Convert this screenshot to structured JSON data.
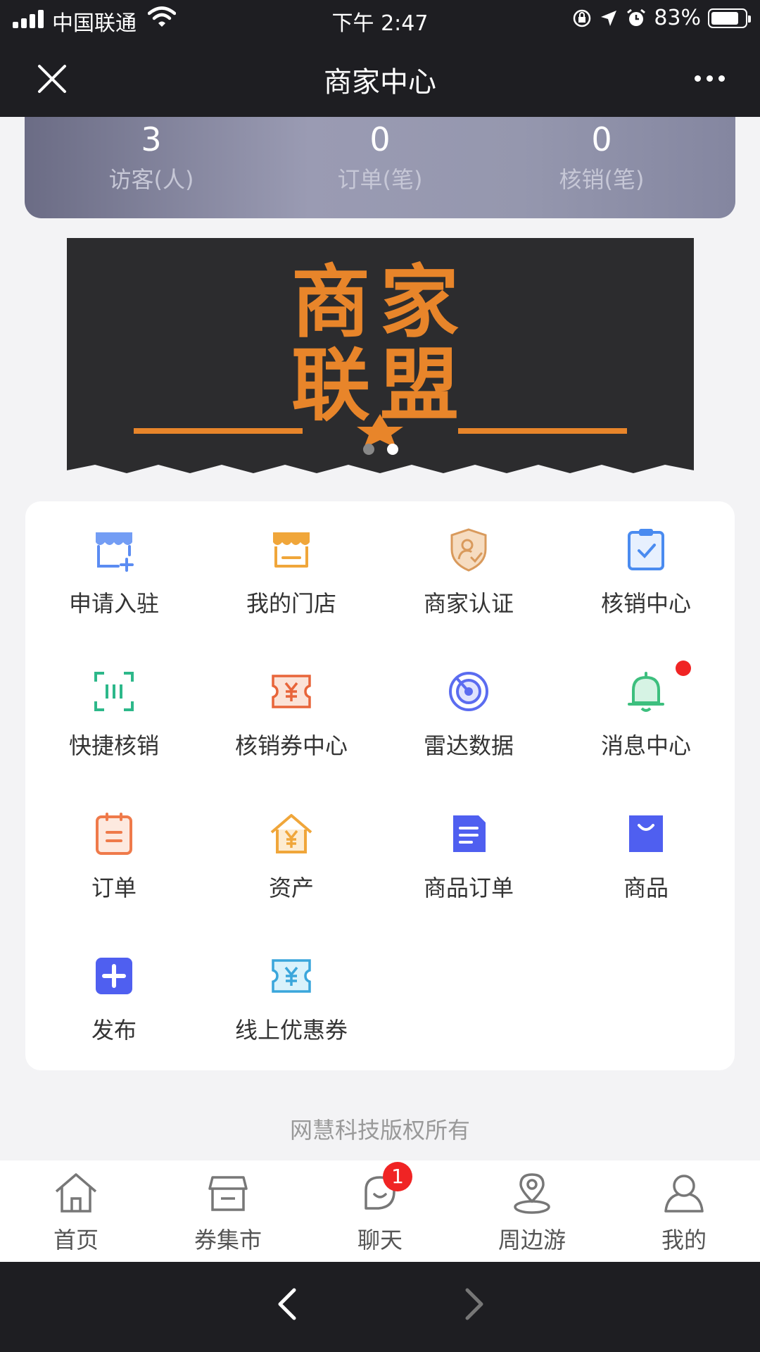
{
  "status_bar": {
    "carrier": "中国联通",
    "time": "下午 2:47",
    "battery": "83%",
    "battery_level": 0.83
  },
  "header": {
    "title": "商家中心",
    "close_icon": "close-icon",
    "more_icon": "more-icon"
  },
  "stats": [
    {
      "value": "3",
      "label": "访客(人)"
    },
    {
      "value": "0",
      "label": "订单(笔)"
    },
    {
      "value": "0",
      "label": "核销(笔)"
    }
  ],
  "banner": {
    "logo_text": "商家联盟",
    "slide_count": 2,
    "active_slide": 2
  },
  "grid": [
    {
      "label": "申请入驻",
      "icon": "store-add-icon"
    },
    {
      "label": "我的门店",
      "icon": "store-icon"
    },
    {
      "label": "商家认证",
      "icon": "shield-user-icon"
    },
    {
      "label": "核销中心",
      "icon": "clipboard-check-icon"
    },
    {
      "label": "快捷核销",
      "icon": "scan-icon"
    },
    {
      "label": "核销券中心",
      "icon": "yen-ticket-icon"
    },
    {
      "label": "雷达数据",
      "icon": "radar-icon"
    },
    {
      "label": "消息中心",
      "icon": "bell-icon"
    },
    {
      "label": "订单",
      "icon": "order-icon"
    },
    {
      "label": "资产",
      "icon": "house-yen-icon"
    },
    {
      "label": "商品订单",
      "icon": "document-icon"
    },
    {
      "label": "商品",
      "icon": "bag-icon"
    },
    {
      "label": "发布",
      "icon": "plus-icon"
    },
    {
      "label": "线上优惠券",
      "icon": "coupon-icon"
    }
  ],
  "copyright": "网慧科技版权所有",
  "tabbar": [
    {
      "label": "首页",
      "icon": "home-icon"
    },
    {
      "label": "券集市",
      "icon": "market-icon"
    },
    {
      "label": "聊天",
      "icon": "chat-icon",
      "badge": "1"
    },
    {
      "label": "周边游",
      "icon": "location-icon"
    },
    {
      "label": "我的",
      "icon": "user-icon"
    }
  ],
  "colors": {
    "header_bg": "#1e1e22",
    "accent_orange": "#e8852a",
    "accent_blue": "#4a7cf0",
    "badge_red": "#f02424"
  }
}
